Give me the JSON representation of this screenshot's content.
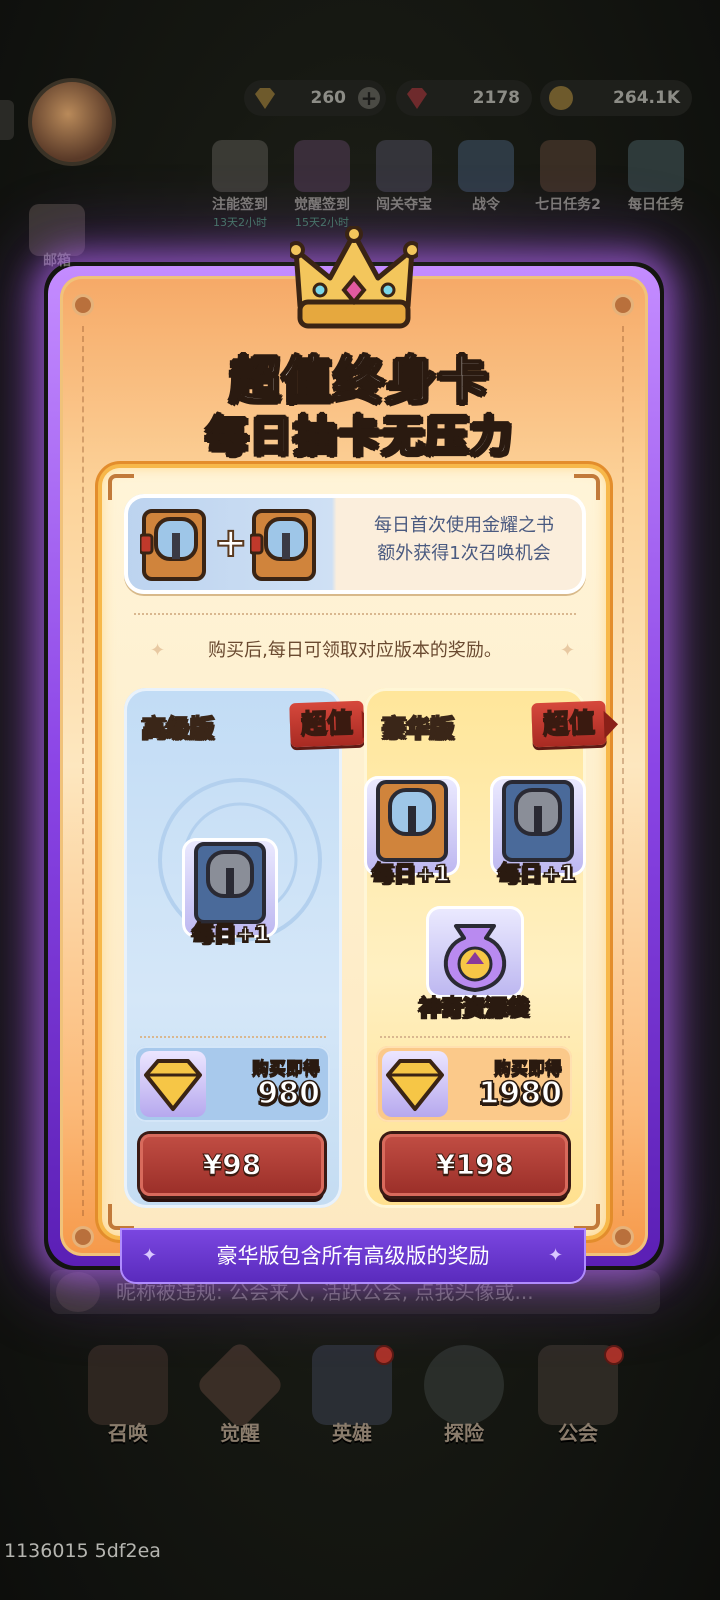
{
  "resources": [
    {
      "icon": "gold-gem-icon",
      "value": "260"
    },
    {
      "icon": "red-gem-icon",
      "value": "2178"
    },
    {
      "icon": "coin-icon",
      "value": "264.1K"
    }
  ],
  "top_icons": [
    {
      "label": "注能签到",
      "sub": "13天2小时"
    },
    {
      "label": "觉醒签到",
      "sub": "15天2小时"
    },
    {
      "label": "闯关夺宝",
      "sub": ""
    },
    {
      "label": "战令",
      "sub": ""
    },
    {
      "label": "七日任务2",
      "sub": ""
    },
    {
      "label": "每日任务",
      "sub": ""
    }
  ],
  "side_left": {
    "mail": "邮箱"
  },
  "popup": {
    "title_line1": "超值终身卡",
    "title_line2": "每日抽卡无压力",
    "book_desc_line1": "每日首次使用金耀之书",
    "book_desc_line2": "额外获得1次召唤机会",
    "info": "购买后,每日可领取对应版本的奖励。",
    "advanced": {
      "title": "高级版",
      "ribbon": "超值",
      "item_label": "每日+1",
      "reward_caption": "购买即得",
      "reward_amount": "980",
      "price": "¥98"
    },
    "deluxe": {
      "title": "豪华版",
      "ribbon": "超值",
      "item1_label": "每日+1",
      "item2_label": "每日+1",
      "bag_label": "神奇资源袋",
      "reward_caption": "购买即得",
      "reward_amount": "1980",
      "price": "¥198"
    },
    "bottom_banner": "豪华版包含所有高级版的奖励"
  },
  "chat": {
    "text": "昵称被违规: 公会来人, 活跃公会, 点我头像或..."
  },
  "bottom_nav": [
    {
      "label": "召唤"
    },
    {
      "label": "觉醒"
    },
    {
      "label": "英雄"
    },
    {
      "label": "探险"
    },
    {
      "label": "公会"
    }
  ],
  "build_id": "1136015 5df2ea",
  "colors": {
    "popup_frame": "#8b45e6",
    "price_button": "#b03a32",
    "banner": "#6a36cf"
  }
}
